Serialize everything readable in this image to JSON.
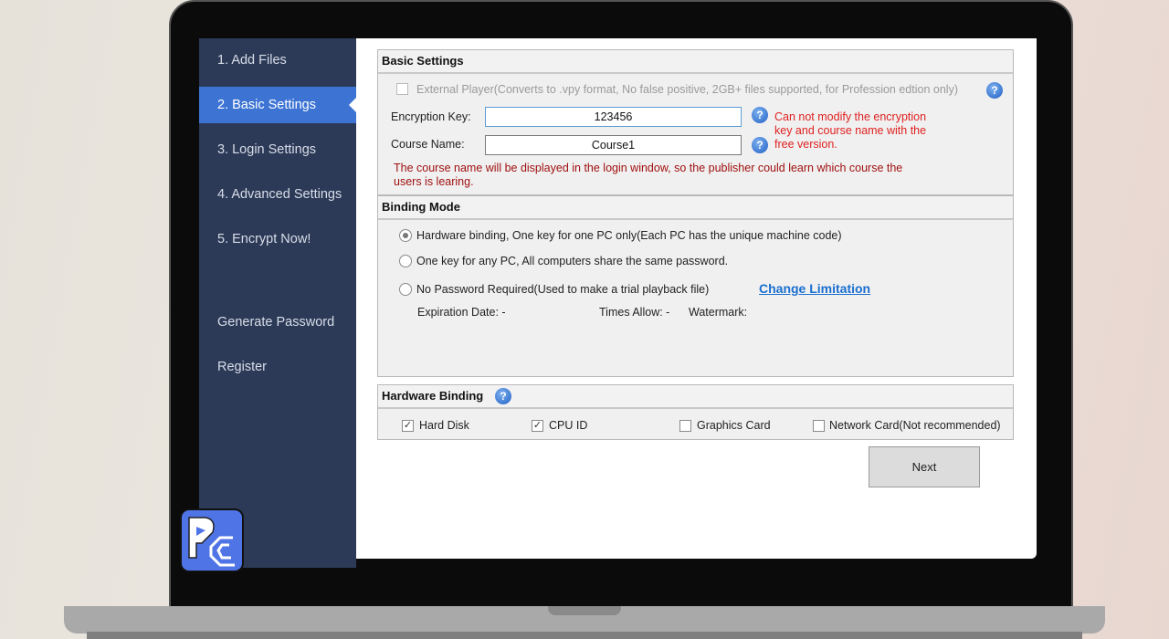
{
  "sidebar": {
    "items": [
      "1. Add Files",
      "2. Basic Settings",
      "3. Login Settings",
      "4. Advanced Settings",
      "5. Encrypt Now!"
    ],
    "extra": [
      "Generate Password",
      "Register"
    ]
  },
  "basic": {
    "title": "Basic Settings",
    "external_player": "External Player(Converts to .vpy format, No false positive, 2GB+ files supported, for Profession edtion only)",
    "key_label": "Encryption Key:",
    "key_value": "123456",
    "course_label": "Course Name:",
    "course_value": "Course1",
    "warning": "Can not modify the encryption key and course name with the free version.",
    "note": "The course name will be displayed in the login window, so the publisher could learn which course the users is learing."
  },
  "binding": {
    "title": "Binding Mode",
    "options": [
      "Hardware binding, One key for one PC only(Each PC has the unique machine code)",
      "One key for any PC, All computers share the same password.",
      "No Password Required(Used to make a trial playback file)"
    ],
    "selected": 0,
    "change_limitation": "Change Limitation",
    "expiration": "Expiration Date:  -",
    "times": "Times Allow:  -",
    "watermark": "Watermark:"
  },
  "hardware": {
    "title": "Hardware Binding",
    "items": [
      {
        "label": "Hard Disk",
        "checked": true
      },
      {
        "label": "CPU ID",
        "checked": true
      },
      {
        "label": "Graphics Card",
        "checked": false
      },
      {
        "label": "Network Card(Not recommended)",
        "checked": false
      }
    ]
  },
  "next_label": "Next",
  "help_glyph": "?"
}
